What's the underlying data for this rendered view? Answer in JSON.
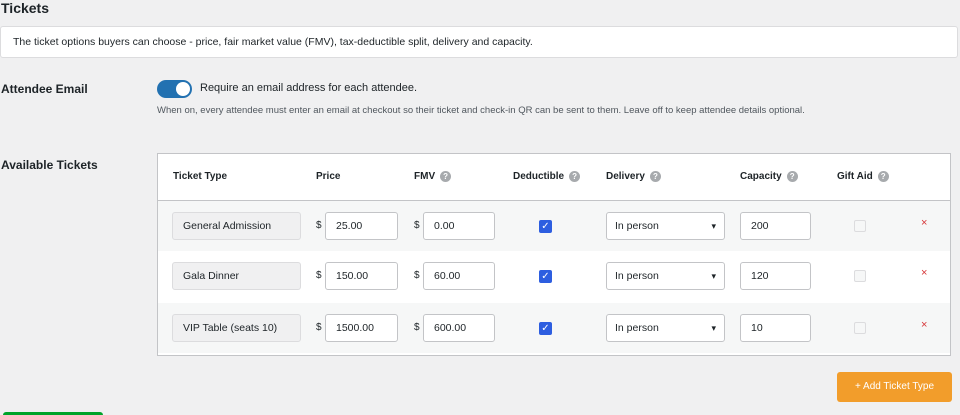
{
  "page": {
    "title": "Tickets"
  },
  "notice": {
    "text": "The ticket options buyers can choose - price, fair market value (FMV), tax-deductible split, delivery and capacity."
  },
  "attendee_email": {
    "label": "Attendee Email",
    "toggle_on": true,
    "toggle_label": "Require an email address for each attendee.",
    "help": "When on, every attendee must enter an email at checkout so their ticket and check-in QR can be sent to them. Leave off to keep attendee details optional."
  },
  "tickets": {
    "label": "Available Tickets",
    "headers": {
      "type": "Ticket Type",
      "price": "Price",
      "fmv": "FMV",
      "deductible": "Deductible",
      "delivery": "Delivery",
      "capacity": "Capacity",
      "gift_aid": "Gift Aid"
    },
    "currency": "$",
    "rows": [
      {
        "name": "General Admission",
        "price": "25.00",
        "fmv": "0.00",
        "deductible": true,
        "delivery": "In person",
        "capacity": "200",
        "gift_aid": false
      },
      {
        "name": "Gala Dinner",
        "price": "150.00",
        "fmv": "60.00",
        "deductible": true,
        "delivery": "In person",
        "capacity": "120",
        "gift_aid": false
      },
      {
        "name": "VIP Table (seats 10)",
        "price": "1500.00",
        "fmv": "600.00",
        "deductible": true,
        "delivery": "In person",
        "capacity": "10",
        "gift_aid": false
      }
    ],
    "remove_glyph": "×",
    "add_button": "+ Add Ticket Type"
  },
  "colors": {
    "accent": "#2271b1",
    "checkbox": "#2d5ee0",
    "add_button": "#f29d2b",
    "remove": "#d63638"
  }
}
